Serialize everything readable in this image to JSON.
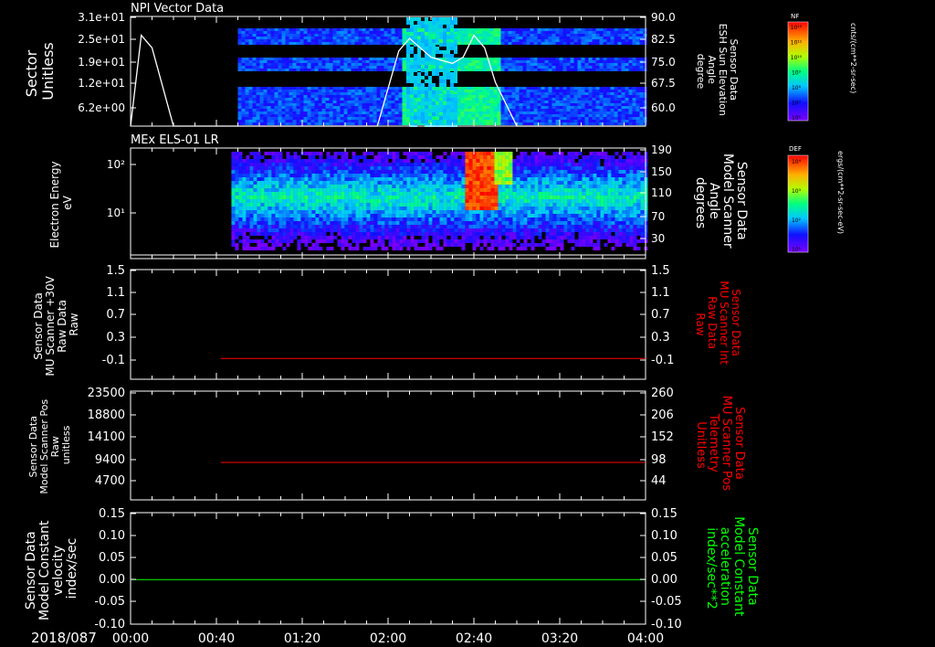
{
  "figure": {
    "date_label": "2018/087",
    "time_ticks": [
      "00:00",
      "00:40",
      "01:20",
      "02:00",
      "02:40",
      "03:20",
      "04:00"
    ]
  },
  "colors": {
    "white": "#ffffff",
    "red": "#ff0000",
    "green": "#00ff00",
    "frame": "#ffffff"
  },
  "panels": {
    "p1": {
      "title": "NPI Vector Data",
      "left_label": [
        "Sector",
        "Unitless"
      ],
      "left_ticks": [
        "3.1e+01",
        "2.5e+01",
        "1.9e+01",
        "1.2e+01",
        "6.2e+00"
      ],
      "right_label": [
        "Sensor Data",
        "ESH Sun Elevation",
        "Angle",
        "degree"
      ],
      "right_ticks": [
        "90.0",
        "82.5",
        "75.0",
        "67.5",
        "60.0"
      ],
      "colorbar_title": "NF",
      "colorbar_unit": "cnts/(cm**2-sr-sec)",
      "colorbar_ticks": [
        "10¹²",
        "10¹¹",
        "10¹⁰",
        "10⁹",
        "10⁸",
        "10⁷",
        "10⁶"
      ]
    },
    "p2": {
      "title": "MEx ELS-01 LR",
      "left_label": [
        "Electron Energy",
        "eV"
      ],
      "left_ticks": [
        "10²",
        "10¹"
      ],
      "right_label": [
        "Sensor Data",
        "Model Scanner",
        "Angle",
        "degrees"
      ],
      "right_ticks": [
        "190",
        "150",
        "110",
        "70",
        "30"
      ],
      "colorbar_title": "DEF",
      "colorbar_unit": "ergs/(cm**2-sr-sec-eV)",
      "colorbar_ticks": [
        "10⁴",
        "10³",
        "10²",
        "10¹"
      ]
    },
    "p3": {
      "left_label": [
        "Sensor Data",
        "MU Scanner +30V",
        "Raw Data",
        "Raw"
      ],
      "left_ticks": [
        "1.5",
        "1.1",
        "0.7",
        "0.3",
        "-0.1"
      ],
      "right_label": [
        "Sensor Data",
        "MU Scanner Int",
        "Raw Data",
        "Raw"
      ],
      "right_ticks": [
        "1.5",
        "1.1",
        "0.7",
        "0.3",
        "-0.1"
      ]
    },
    "p4": {
      "left_label": [
        "Sensor Data",
        "Model Scanner Pos",
        "Raw",
        "unitless"
      ],
      "left_ticks": [
        "23500",
        "18800",
        "14100",
        "9400",
        "4700"
      ],
      "right_label": [
        "Sensor Data",
        "MU Scanner Pos",
        "Telemetry",
        "Unitless"
      ],
      "right_ticks": [
        "260",
        "206",
        "152",
        "98",
        "44"
      ]
    },
    "p5": {
      "left_label": [
        "Sensor Data",
        "Model Constant",
        "velocity",
        "index/sec"
      ],
      "left_ticks": [
        "0.15",
        "0.10",
        "0.05",
        "0.00",
        "-0.05",
        "-0.10"
      ],
      "right_label": [
        "Sensor Data",
        "Model Constant",
        "acceleration",
        "index/sec**2"
      ],
      "right_ticks": [
        "0.15",
        "0.10",
        "0.05",
        "0.00",
        "-0.05",
        "-0.10"
      ]
    }
  },
  "chart_data": [
    {
      "type": "heatmap",
      "title": "NPI Vector Data",
      "x_range": [
        "00:00",
        "04:00"
      ],
      "ylabel": "Sector Unitless",
      "data_start": "00:50",
      "overlay_line": {
        "name": "ESH Sun Elevation Angle",
        "x": [
          "00:00",
          "00:05",
          "00:10",
          "00:20",
          "01:55",
          "02:05",
          "02:10",
          "02:20",
          "02:30",
          "02:35",
          "02:40",
          "02:45",
          "02:50",
          "03:00",
          "04:00"
        ],
        "y": [
          55,
          84,
          80,
          55,
          55,
          79,
          83,
          77,
          75,
          77,
          84,
          80,
          69,
          55,
          55
        ]
      }
    },
    {
      "type": "heatmap",
      "title": "MEx ELS-01 LR",
      "x_range": [
        "00:00",
        "04:00"
      ],
      "ylabel": "Electron Energy eV",
      "data_start": "00:47",
      "overlay_line": {
        "name": "Model Scanner Angle",
        "x": [
          "00:00",
          "04:00"
        ],
        "y": [
          16,
          16
        ]
      }
    },
    {
      "type": "line",
      "series": [
        {
          "x": [
            "00:42",
            "04:00"
          ],
          "y": [
            0.0,
            0.0
          ],
          "color": "#ff0000"
        }
      ],
      "ylim": [
        -0.35,
        1.5
      ]
    },
    {
      "type": "line",
      "series": [
        {
          "x": [
            "00:42",
            "04:00"
          ],
          "y": [
            8100,
            8100
          ],
          "color": "#ff0000"
        }
      ],
      "ylim": [
        0,
        23500
      ]
    },
    {
      "type": "line",
      "series": [
        {
          "x": [
            "00:00",
            "04:00"
          ],
          "y": [
            0.0,
            0.0
          ],
          "color": "#00ff00"
        }
      ],
      "ylim": [
        -0.1,
        0.15
      ]
    }
  ]
}
